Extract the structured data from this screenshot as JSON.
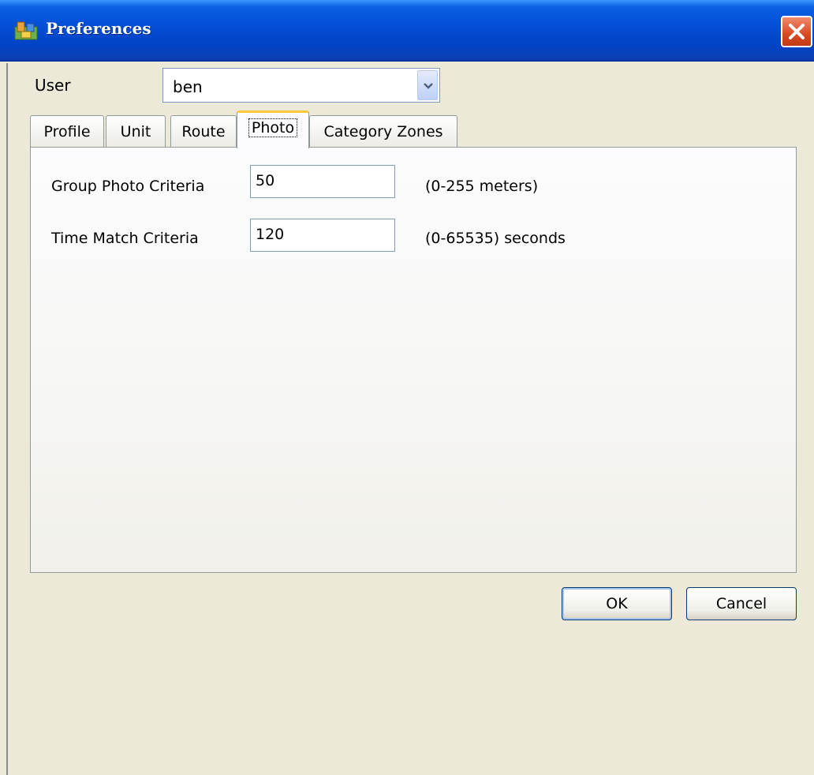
{
  "window": {
    "title": "Preferences"
  },
  "user": {
    "label": "User",
    "selected": "ben"
  },
  "tabs": [
    {
      "label": "Profile"
    },
    {
      "label": "Unit"
    },
    {
      "label": "Route"
    },
    {
      "label": "Photo",
      "active": true
    },
    {
      "label": "Category Zones"
    }
  ],
  "photo": {
    "group": {
      "label": "Group Photo Criteria",
      "value": "50",
      "unit": "(0-255 meters)"
    },
    "time": {
      "label": "Time Match Criteria",
      "value": "120",
      "unit": "(0-65535) seconds"
    }
  },
  "buttons": {
    "ok": "OK",
    "cancel": "Cancel"
  },
  "colors": {
    "titlebar": "#0450D8",
    "face": "#ECE9D8",
    "active_tab_accent": "#FFC83C",
    "close": "#D84A22"
  },
  "icons": {
    "app": "app-map-icon",
    "close": "close-icon",
    "dropdown": "chevron-down-icon"
  }
}
